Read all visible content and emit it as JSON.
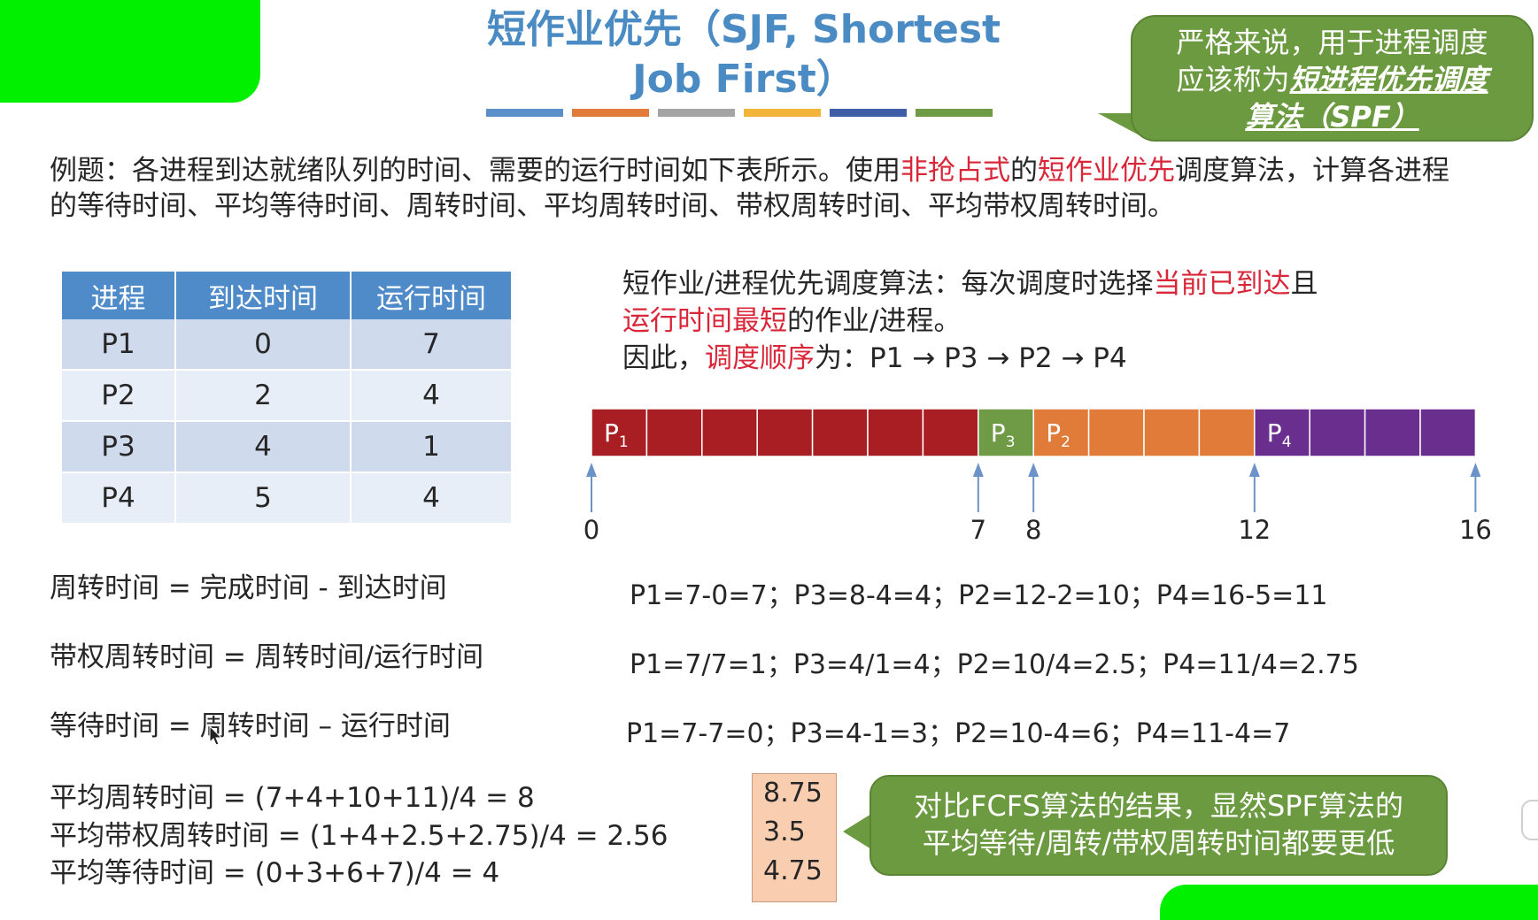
{
  "slide": {
    "title_line1": "短作业优先（SJF, Shortest",
    "title_line2": "Job First）",
    "title_bar_colors": [
      "#5b8fc9",
      "#e07b39",
      "#a5a5a5",
      "#f2b53a",
      "#3f5ea8",
      "#6f9a46"
    ],
    "callout_top": {
      "line1": "严格来说，用于进程调度",
      "line2_prefix": "应该称为",
      "line2_emph": "短进程优先调度",
      "line3_emph": "算法（SPF）"
    },
    "problem": {
      "part1": "例题：各进程到达就绪队列的时间、需要的运行时间如下表所示。使用",
      "red1": "非抢占式",
      "part2": "的",
      "red2": "短作业优先",
      "part3": "调度算法，计算各进程的等待时间、平均等待时间、周转时间、平均周转时间、带权周转时间、平均带权周转时间。"
    },
    "table": {
      "headers": [
        "进程",
        "到达时间",
        "运行时间"
      ],
      "rows": [
        [
          "P1",
          "0",
          "7"
        ],
        [
          "P2",
          "2",
          "4"
        ],
        [
          "P3",
          "4",
          "1"
        ],
        [
          "P4",
          "5",
          "4"
        ]
      ]
    },
    "algo": {
      "l1_a": "短作业/进程优先调度算法：每次调度时选择",
      "l1_red": "当前已到达",
      "l1_b": "且",
      "l2_red": "运行时间最短",
      "l2_b": "的作业/进程。",
      "l3_a": "因此，",
      "l3_red": "调度顺序",
      "l3_b": "为：P1 → P3 → P2 → P4"
    },
    "gantt": {
      "segments": [
        {
          "proc": "P",
          "sub": "1",
          "start": 0,
          "end": 7,
          "color": "#a81e23"
        },
        {
          "proc": "P",
          "sub": "3",
          "start": 7,
          "end": 8,
          "color": "#6f9a46"
        },
        {
          "proc": "P",
          "sub": "2",
          "start": 8,
          "end": 12,
          "color": "#e07b39"
        },
        {
          "proc": "P",
          "sub": "4",
          "start": 12,
          "end": 16,
          "color": "#6a2e8f"
        }
      ],
      "ticks": [
        "0",
        "7",
        "8",
        "12",
        "16"
      ],
      "tick_values": [
        0,
        7,
        8,
        12,
        16
      ]
    },
    "formulas": {
      "turnaround_def": "周转时间 = 完成时间 - 到达时间",
      "turnaround_calc": "P1=7-0=7；P3=8-4=4；P2=12-2=10；P4=16-5=11",
      "weighted_def": "带权周转时间 = 周转时间/运行时间",
      "weighted_calc": "P1=7/7=1；P3=4/1=4；P2=10/4=2.5；P4=11/4=2.75",
      "wait_def": "等待时间 = 周转时间 – 运行时间",
      "wait_calc": "P1=7-7=0；P3=4-1=3；P2=10-4=6；P4=11-4=7",
      "avg_turnaround": "平均周转时间 = (7+4+10+11)/4 = 8",
      "avg_weighted": "平均带权周转时间 = (1+4+2.5+2.75)/4 = 2.56",
      "avg_wait": "平均等待时间 = (0+3+6+7)/4 = 4"
    },
    "fcfs_results": [
      "8.75",
      "3.5",
      "4.75"
    ],
    "callout_bottom": {
      "line1": "对比FCFS算法的结果，显然SPF算法的",
      "line2": "平均等待/周转/带权周转时间都要更低"
    }
  }
}
